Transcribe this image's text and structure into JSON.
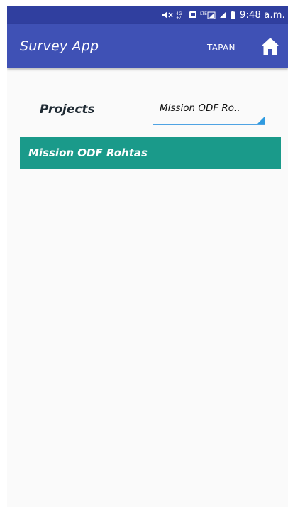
{
  "status_bar": {
    "time": "9:48 a.m.",
    "icons": [
      "mute-icon",
      "data-icon",
      "notification-icon",
      "lte-signal-icon",
      "signal-icon",
      "battery-icon"
    ]
  },
  "app_bar": {
    "title": "Survey App",
    "user": "TAPAN",
    "home_icon": "home-icon"
  },
  "form": {
    "projects_label": "Projects",
    "selected_project": "Mission ODF Ro..",
    "options": [
      "Mission ODF Rohtas"
    ]
  },
  "colors": {
    "status_bar": "#303f9f",
    "app_bar": "#3f51b5",
    "dropdown_item": "#1a9a8a",
    "spinner_underline": "#4fa3e3"
  }
}
